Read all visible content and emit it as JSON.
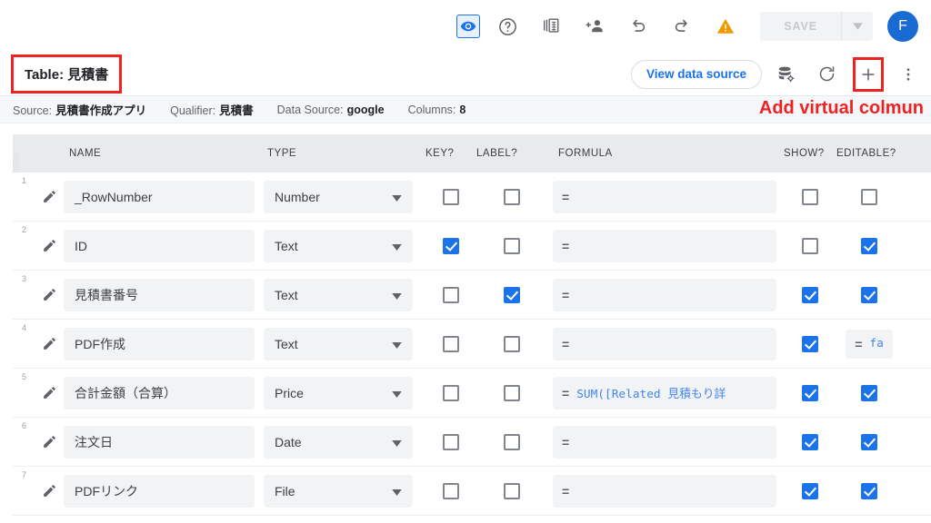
{
  "topbar": {
    "icons": [
      {
        "name": "preview-eye-icon",
        "label": "Preview"
      },
      {
        "name": "help-icon",
        "label": "Help"
      },
      {
        "name": "copy-app-icon",
        "label": "Copy app"
      },
      {
        "name": "add-user-icon",
        "label": "Add user"
      },
      {
        "name": "undo-icon",
        "label": "Undo"
      },
      {
        "name": "redo-icon",
        "label": "Redo"
      },
      {
        "name": "warning-icon",
        "label": "Warning"
      }
    ],
    "save_label": "SAVE",
    "avatar_initial": "F"
  },
  "table_header": {
    "title": "Table: 見積書",
    "view_data_source_label": "View data source",
    "icons": [
      {
        "name": "data-source-settings-icon"
      },
      {
        "name": "refresh-icon"
      },
      {
        "name": "add-virtual-column-icon"
      },
      {
        "name": "more-vertical-icon"
      }
    ]
  },
  "annotation": {
    "text": "Add virtual colmun",
    "color": "#ef2121"
  },
  "meta": {
    "source_label": "Source:",
    "source_value": "見積書作成アプリ",
    "qualifier_label": "Qualifier:",
    "qualifier_value": "見積書",
    "data_source_label": "Data Source:",
    "data_source_value": "google",
    "columns_label": "Columns:",
    "columns_value": "8"
  },
  "grid": {
    "headers": {
      "name": "NAME",
      "type": "TYPE",
      "key": "KEY?",
      "label": "LABEL?",
      "formula": "FORMULA",
      "show": "SHOW?",
      "editable": "EDITABLE?"
    },
    "formula_prefix": "=",
    "rows": [
      {
        "num": "1",
        "name": "_RowNumber",
        "type": "Number",
        "key": false,
        "label": false,
        "formula": "",
        "show": false,
        "editable": false,
        "editable_is_formula": false
      },
      {
        "num": "2",
        "name": "ID",
        "type": "Text",
        "key": true,
        "label": false,
        "formula": "",
        "show": false,
        "editable": true,
        "editable_is_formula": false
      },
      {
        "num": "3",
        "name": "見積書番号",
        "type": "Text",
        "key": false,
        "label": true,
        "formula": "",
        "show": true,
        "editable": true,
        "editable_is_formula": false
      },
      {
        "num": "4",
        "name": "PDF作成",
        "type": "Text",
        "key": false,
        "label": false,
        "formula": "",
        "show": true,
        "editable": false,
        "editable_is_formula": true,
        "editable_formula_text": "fa"
      },
      {
        "num": "5",
        "name": "合計金額（合算）",
        "type": "Price",
        "key": false,
        "label": false,
        "formula": "SUM([Related 見積もり詳",
        "show": true,
        "editable": true,
        "editable_is_formula": false
      },
      {
        "num": "6",
        "name": "注文日",
        "type": "Date",
        "key": false,
        "label": false,
        "formula": "",
        "show": true,
        "editable": true,
        "editable_is_formula": false
      },
      {
        "num": "7",
        "name": "PDFリンク",
        "type": "File",
        "key": false,
        "label": false,
        "formula": "",
        "show": true,
        "editable": true,
        "editable_is_formula": false
      }
    ]
  },
  "colors": {
    "accent_blue": "#1a73e8",
    "warning_orange": "#f29900",
    "annotation_red": "#ef2121",
    "formula_blue": "#4285f4"
  }
}
